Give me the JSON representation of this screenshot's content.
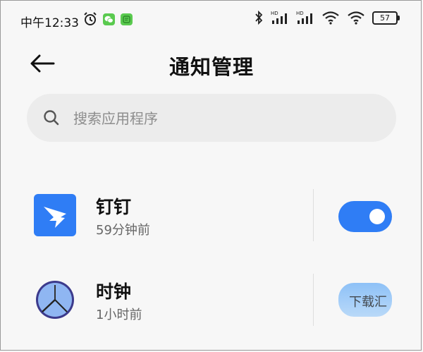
{
  "status_bar": {
    "time": "中午12:33",
    "battery": "57",
    "icons_left": [
      "alarm-icon",
      "wechat-icon",
      "message-icon"
    ],
    "icons_right": [
      "bluetooth-icon",
      "signal-hd-icon",
      "signal-hd-icon",
      "wifi-icon",
      "wifi-icon",
      "battery-icon"
    ]
  },
  "header": {
    "title": "通知管理",
    "back_icon": "back-arrow-icon"
  },
  "search": {
    "placeholder": "搜索应用程序",
    "icon": "search-icon"
  },
  "apps": [
    {
      "name": "钉钉",
      "time": "59分钟前",
      "icon": "dingtalk-icon",
      "enabled": true,
      "accent": "#2f7df5"
    },
    {
      "name": "时钟",
      "time": "1小时前",
      "icon": "clock-icon",
      "enabled": true
    }
  ],
  "watermark": "下载汇",
  "colors": {
    "accent": "#2f7df5",
    "background": "#f7f7f7",
    "search_bg": "#ececec"
  }
}
